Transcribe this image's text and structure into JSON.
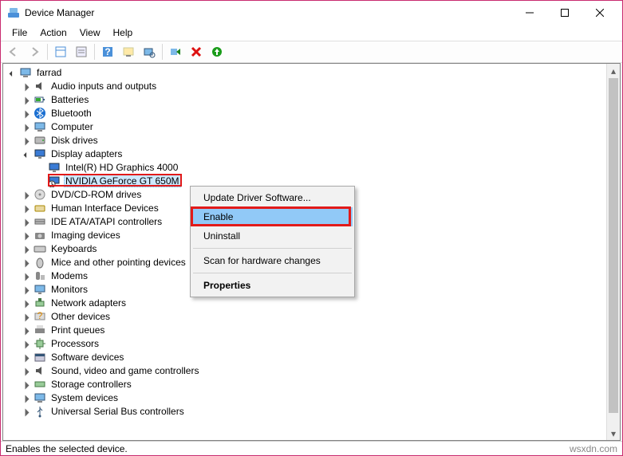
{
  "window": {
    "title": "Device Manager"
  },
  "menu": {
    "file": "File",
    "action": "Action",
    "view": "View",
    "help": "Help"
  },
  "root": {
    "label": "farrad"
  },
  "tree": {
    "audio": "Audio inputs and outputs",
    "batteries": "Batteries",
    "bluetooth": "Bluetooth",
    "computer": "Computer",
    "disk": "Disk drives",
    "display": "Display adapters",
    "display_c1": "Intel(R) HD Graphics 4000",
    "display_c2": "NVIDIA GeForce GT 650M",
    "dvd": "DVD/CD-ROM drives",
    "hid": "Human Interface Devices",
    "ide": "IDE ATA/ATAPI controllers",
    "imaging": "Imaging devices",
    "keyboards": "Keyboards",
    "mice": "Mice and other pointing devices",
    "modems": "Modems",
    "monitors": "Monitors",
    "network": "Network adapters",
    "other": "Other devices",
    "print": "Print queues",
    "processors": "Processors",
    "software": "Software devices",
    "sound": "Sound, video and game controllers",
    "storage": "Storage controllers",
    "system": "System devices",
    "usb": "Universal Serial Bus controllers"
  },
  "context_menu": {
    "update": "Update Driver Software...",
    "enable": "Enable",
    "uninstall": "Uninstall",
    "scan": "Scan for hardware changes",
    "properties": "Properties"
  },
  "status": {
    "text": "Enables the selected device.",
    "watermark": "wsxdn.com"
  },
  "icons": {
    "back": "back-icon",
    "forward": "forward-icon",
    "show": "show-hidden-icon",
    "prop": "properties-icon",
    "help": "help-icon",
    "update": "update-driver-icon",
    "scan": "scan-hardware-icon",
    "uninstall": "uninstall-icon",
    "enable": "enable-icon",
    "add": "add-legacy-icon"
  }
}
